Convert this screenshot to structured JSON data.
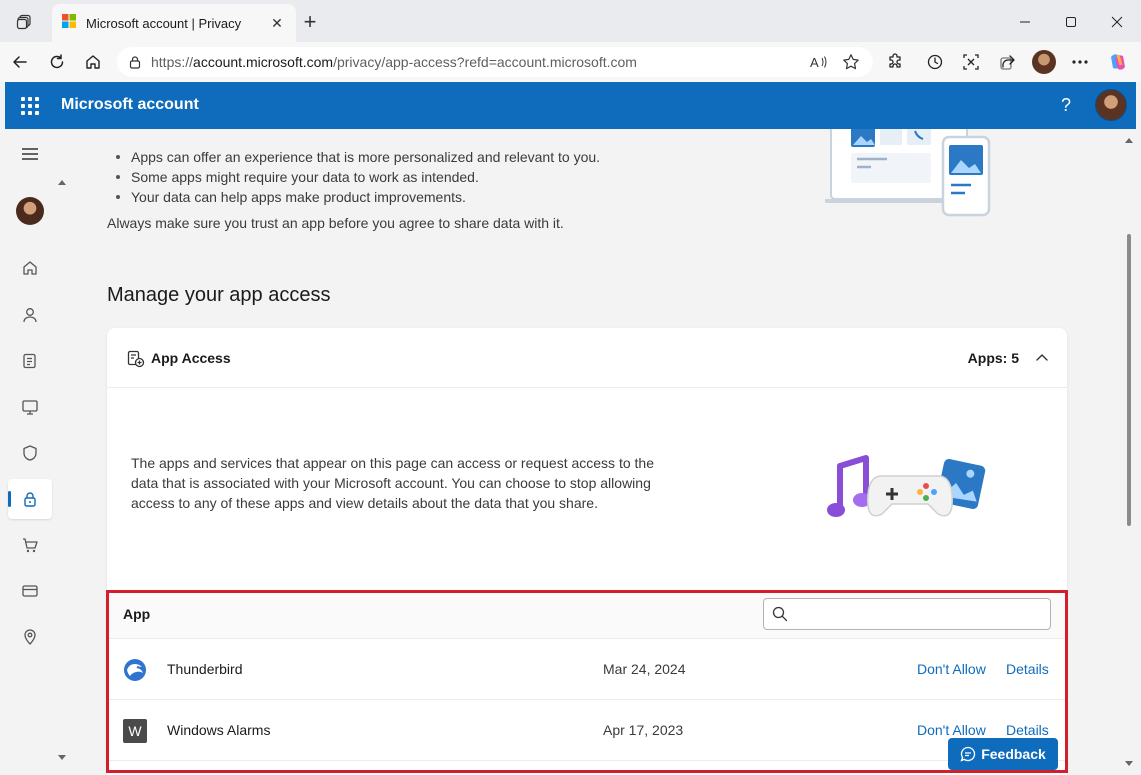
{
  "browser": {
    "tab_title": "Microsoft account | Privacy",
    "url_prefix": "https://",
    "url_host": "account.microsoft.com",
    "url_path": "/privacy/app-access?refd=account.microsoft.com"
  },
  "site": {
    "brand": "Microsoft account",
    "help": "?"
  },
  "rail": {
    "items": [
      "menu-icon",
      "avatar",
      "home-icon",
      "person-icon",
      "rewards-icon",
      "devices-icon",
      "shield-icon",
      "lock-icon",
      "cart-icon",
      "card-icon",
      "location-icon"
    ],
    "active": "lock-icon"
  },
  "intro": {
    "bullets": [
      "Apps can offer an experience that is more personalized and relevant to you.",
      "Some apps might require your data to work as intended.",
      "Your data can help apps make product improvements."
    ],
    "trust_note": "Always make sure you trust an app before you agree to share data with it."
  },
  "section": {
    "title": "Manage your app access"
  },
  "card": {
    "title": "App Access",
    "apps_count": "Apps: 5",
    "description": "The apps and services that appear on this page can access or request access to the data that is associated with your Microsoft account. You can choose to stop allowing access to any of these apps and view details about the data that you share."
  },
  "table": {
    "header_app": "App",
    "search_value": "",
    "search_placeholder": "",
    "rows": [
      {
        "name": "Thunderbird",
        "date": "Mar 24, 2024",
        "deny": "Don't Allow",
        "details": "Details",
        "icon": "thunderbird-icon"
      },
      {
        "name": "Windows Alarms",
        "date": "Apr 17, 2023",
        "deny": "Don't Allow",
        "details": "Details",
        "icon": "windows-alarms-icon",
        "icon_letter": "W"
      }
    ]
  },
  "feedback": "Feedback",
  "colors": {
    "brand": "#0f6cbd",
    "highlight": "#d21f2b"
  }
}
